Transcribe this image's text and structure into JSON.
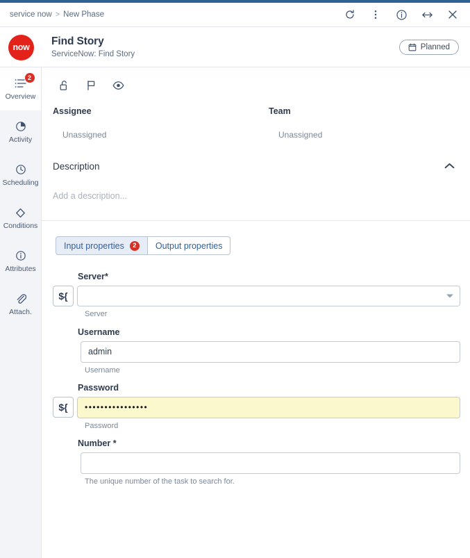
{
  "window": {
    "breadcrumb": {
      "root": "service now",
      "separator": ">",
      "current": "New Phase"
    },
    "actions": [
      {
        "name": "refresh-icon",
        "label": "Refresh"
      },
      {
        "name": "more-options-icon",
        "label": "More options"
      },
      {
        "name": "info-icon",
        "label": "Info"
      },
      {
        "name": "expand-icon",
        "label": "Expand"
      },
      {
        "name": "close-icon",
        "label": "Close"
      }
    ]
  },
  "header": {
    "logo_text": "now",
    "title": "Find Story",
    "subtitle": "ServiceNow: Find Story",
    "status": {
      "label": "Planned",
      "icon": "calendar-icon"
    }
  },
  "sidebar": {
    "items": [
      {
        "label": "Overview",
        "icon": "list-icon",
        "badge": "2",
        "active": true
      },
      {
        "label": "Activity",
        "icon": "pie-chart-icon",
        "badge": "",
        "active": false
      },
      {
        "label": "Scheduling",
        "icon": "clock-icon",
        "badge": "",
        "active": false
      },
      {
        "label": "Conditions",
        "icon": "diamond-icon",
        "badge": "",
        "active": false
      },
      {
        "label": "Attributes",
        "icon": "info-icon",
        "badge": "",
        "active": false
      },
      {
        "label": "Attach.",
        "icon": "paperclip-icon",
        "badge": "",
        "active": false
      }
    ]
  },
  "main": {
    "quick_actions": [
      {
        "name": "unlock-icon",
        "label": "Lock"
      },
      {
        "name": "flag-icon",
        "label": "Flag"
      },
      {
        "name": "eye-icon",
        "label": "Watch"
      }
    ],
    "assignee": {
      "label": "Assignee",
      "value": "Unassigned"
    },
    "team": {
      "label": "Team",
      "value": "Unassigned"
    },
    "description": {
      "title": "Description",
      "placeholder": "Add a description...",
      "collapse_icon": "chevron-up-icon"
    },
    "tabs": [
      {
        "label": "Input properties",
        "badge": "2",
        "active": true
      },
      {
        "label": "Output properties",
        "badge": "",
        "active": false
      }
    ],
    "fields": [
      {
        "label": "Server",
        "required": true,
        "required_marker": "*",
        "value": "",
        "hint": "Server",
        "has_var_button": true,
        "var_button_label": "${",
        "has_dropdown": true,
        "masked": false,
        "highlighted": false
      },
      {
        "label": "Username",
        "required": false,
        "required_marker": "",
        "value": "admin",
        "hint": "Username",
        "has_var_button": false,
        "var_button_label": "",
        "has_dropdown": false,
        "masked": false,
        "highlighted": false
      },
      {
        "label": "Password",
        "required": false,
        "required_marker": "",
        "value": "••••••••••••••••",
        "hint": "Password",
        "has_var_button": true,
        "var_button_label": "${",
        "has_dropdown": false,
        "masked": true,
        "highlighted": true
      },
      {
        "label": "Number",
        "required": true,
        "required_marker": "*",
        "value": "",
        "hint": "The unique number of the task to search for.",
        "has_var_button": false,
        "var_button_label": "",
        "has_dropdown": false,
        "masked": false,
        "highlighted": false
      }
    ]
  },
  "colors": {
    "accent_blue": "#2f6193",
    "brand_red": "#e32219",
    "badge_red": "#d93025",
    "tab_active_bg": "#e7edf6",
    "field_highlight": "#fbf8cd",
    "rail_bg": "#f2f4f7",
    "text_primary": "#2e3b4e",
    "text_muted": "#7c8899"
  }
}
